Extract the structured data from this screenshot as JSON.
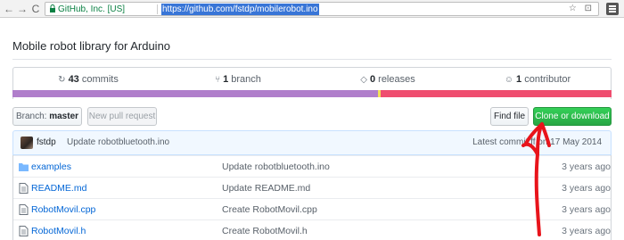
{
  "browser": {
    "back": "←",
    "forward": "→",
    "reload": "C",
    "secure_label": "GitHub, Inc. [US]",
    "url": "https://github.com/fstdp/mobilerobot.ino",
    "icons": "☆ ⊡"
  },
  "repo": {
    "description": "Mobile robot library for Arduino"
  },
  "summary": {
    "commits_count": "43",
    "commits_label": "commits",
    "branch_count": "1",
    "branch_label": "branch",
    "releases_count": "0",
    "releases_label": "releases",
    "contributors_count": "1",
    "contributors_label": "contributor"
  },
  "language_bar": {
    "colors": [
      "#b07ecb",
      "#f1e05a",
      "#ef4d6f"
    ]
  },
  "toolbar": {
    "branch_label": "Branch:",
    "branch_value": "master",
    "new_pr_label": "New pull request",
    "find_file_label": "Find file",
    "clone_label": "Clone or download"
  },
  "commit_tease": {
    "author": "fstdp",
    "message": "Update robotbluetooth.ino",
    "latest_label": "Latest commit ff",
    "date": "on 17 May 2014"
  },
  "files": [
    {
      "icon": "folder-icon",
      "name": "examples",
      "message": "Update robotbluetooth.ino",
      "age": "3 years ago"
    },
    {
      "icon": "file-icon",
      "name": "README.md",
      "message": "Update README.md",
      "age": "3 years ago"
    },
    {
      "icon": "file-icon",
      "name": "RobotMovil.cpp",
      "message": "Create RobotMovil.cpp",
      "age": "3 years ago"
    },
    {
      "icon": "file-icon",
      "name": "RobotMovil.h",
      "message": "Create RobotMovil.h",
      "age": "3 years ago"
    }
  ],
  "annotation": {
    "arrow_color": "#e8141b"
  }
}
